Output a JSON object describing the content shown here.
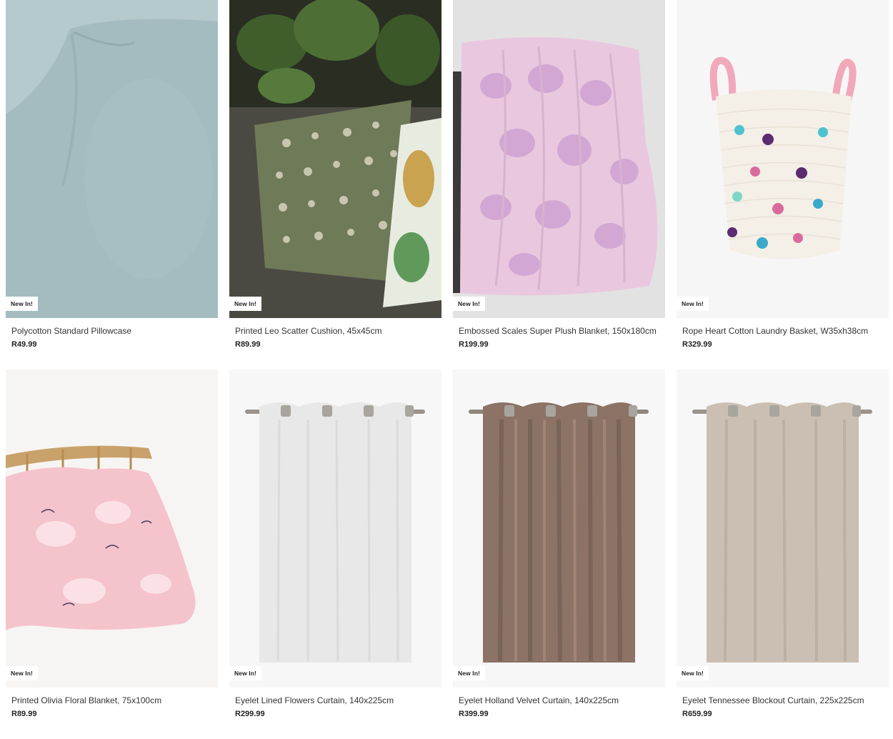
{
  "products": [
    {
      "name": "Polycotton Standard Pillowcase",
      "price": "R49.99",
      "badge": "New In!",
      "image": "light-blue-pillowcase"
    },
    {
      "name": "Printed Leo Scatter Cushion, 45x45cm",
      "price": "R89.99",
      "badge": "New In!",
      "image": "leopard-print-cushion"
    },
    {
      "name": "Embossed Scales Super Plush Blanket, 150x180cm",
      "price": "R199.99",
      "badge": "New In!",
      "image": "pink-plush-blanket"
    },
    {
      "name": "Rope Heart Cotton Laundry Basket, W35xh38cm",
      "price": "R329.99",
      "badge": "New In!",
      "image": "heart-rope-basket"
    },
    {
      "name": "Printed Olivia Floral Blanket, 75x100cm",
      "price": "R89.99",
      "badge": "New In!",
      "image": "pink-floral-blanket"
    },
    {
      "name": "Eyelet Lined Flowers Curtain, 140x225cm",
      "price": "R299.99",
      "badge": "New In!",
      "image": "white-eyelet-curtain"
    },
    {
      "name": "Eyelet Holland Velvet Curtain, 140x225cm",
      "price": "R399.99",
      "badge": "New In!",
      "image": "brown-velvet-curtain"
    },
    {
      "name": "Eyelet Tennessee Blockout Curtain, 225x225cm",
      "price": "R659.99",
      "badge": "New In!",
      "image": "beige-blockout-curtain"
    }
  ]
}
